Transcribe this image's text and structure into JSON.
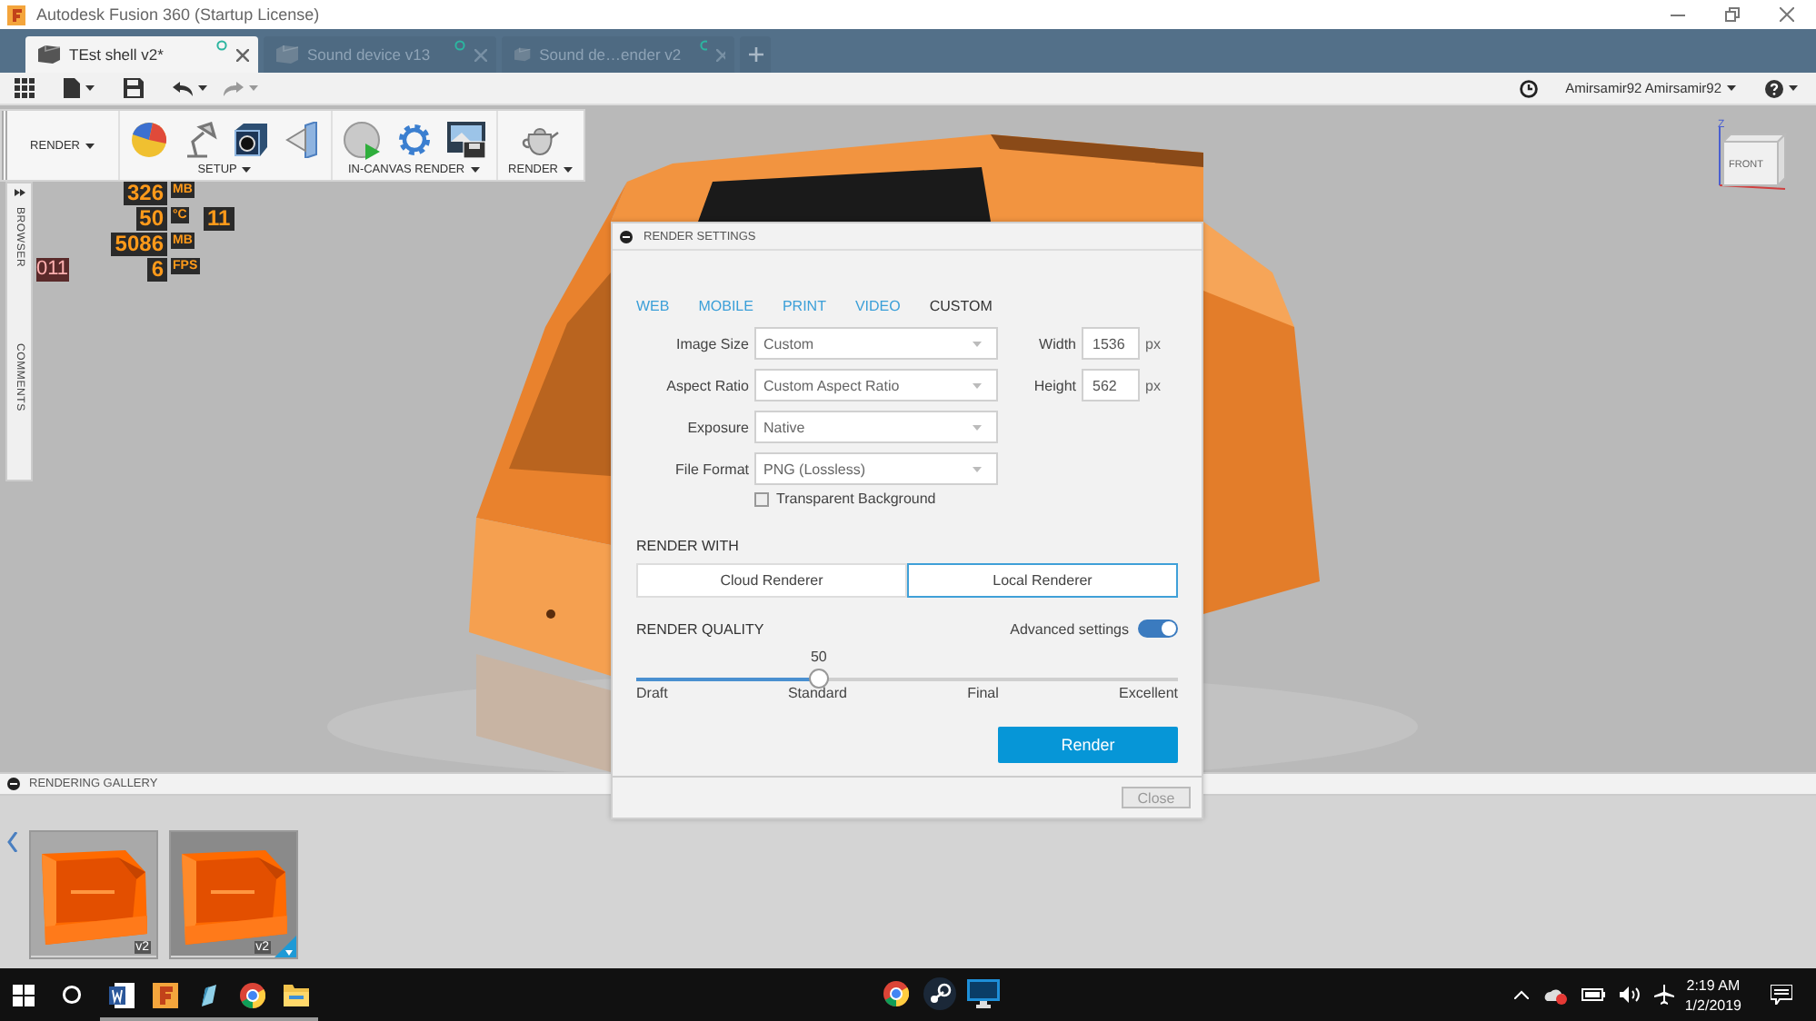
{
  "window": {
    "title": "Autodesk Fusion 360 (Startup License)"
  },
  "tabs": [
    {
      "label": "TEst shell v2*",
      "selected": true
    },
    {
      "label": "Sound device v13",
      "selected": false
    },
    {
      "label": "Sound de…ender v2",
      "selected": false
    }
  ],
  "toolbar": {
    "user": "Amirsamir92 Amirsamir92"
  },
  "ribbon": {
    "workspace": "RENDER",
    "groups": [
      {
        "label": "SETUP"
      },
      {
        "label": "IN-CANVAS RENDER"
      },
      {
        "label": "RENDER"
      }
    ]
  },
  "overlay_stats": [
    {
      "value": "326",
      "unit": "MB"
    },
    {
      "value": "50",
      "unit": "°C"
    },
    {
      "value": "5086",
      "unit": "MB"
    },
    {
      "label": "011",
      "value": "6",
      "unit": "FPS"
    }
  ],
  "overlay_side": "11",
  "side_panel": [
    "BROWSER",
    "COMMENTS"
  ],
  "viewcube": {
    "axis": "Z",
    "face": "FRONT"
  },
  "dialog": {
    "title": "RENDER SETTINGS",
    "tabs": [
      {
        "label": "WEB",
        "selected": false
      },
      {
        "label": "MOBILE",
        "selected": false
      },
      {
        "label": "PRINT",
        "selected": false
      },
      {
        "label": "VIDEO",
        "selected": false
      },
      {
        "label": "CUSTOM",
        "selected": true
      }
    ],
    "fields": [
      {
        "label": "Image Size",
        "value": "Custom"
      },
      {
        "label": "Aspect Ratio",
        "value": "Custom Aspect Ratio"
      },
      {
        "label": "Exposure",
        "value": "Native"
      },
      {
        "label": "File Format",
        "value": "PNG (Lossless)"
      }
    ],
    "size": [
      {
        "label": "Width",
        "value": "1536",
        "unit": "px"
      },
      {
        "label": "Height",
        "value": "562",
        "unit": "px"
      }
    ],
    "transparent": {
      "label": "Transparent Background",
      "checked": false
    },
    "render_with": {
      "title": "RENDER WITH",
      "options": [
        {
          "label": "Cloud Renderer",
          "selected": false
        },
        {
          "label": "Local Renderer",
          "selected": true
        }
      ]
    },
    "quality": {
      "title": "RENDER QUALITY",
      "advanced": {
        "label": "Advanced settings",
        "on": true
      },
      "reading": "50",
      "level": 0.337,
      "ticks": [
        "Draft",
        "Standard",
        "Final",
        "Excellent"
      ]
    },
    "render_button": "Render",
    "close_button": "Close"
  },
  "gallery": {
    "title": "RENDERING GALLERY",
    "items": [
      {
        "badge": "v2",
        "cloud": false
      },
      {
        "badge": "v2",
        "cloud": true
      }
    ]
  },
  "taskbar": {
    "apps": [
      {
        "kind": "word",
        "running": true
      },
      {
        "kind": "fusion",
        "running": true
      },
      {
        "kind": "pen",
        "running": true
      },
      {
        "kind": "chrome",
        "running": true
      },
      {
        "kind": "folder",
        "running": true
      }
    ],
    "center": [
      {
        "kind": "chrome",
        "running": false
      },
      {
        "kind": "steam",
        "running": false
      },
      {
        "kind": "monitor",
        "running": false
      }
    ],
    "time": "2:19 AM",
    "date": "1/2/2019"
  }
}
